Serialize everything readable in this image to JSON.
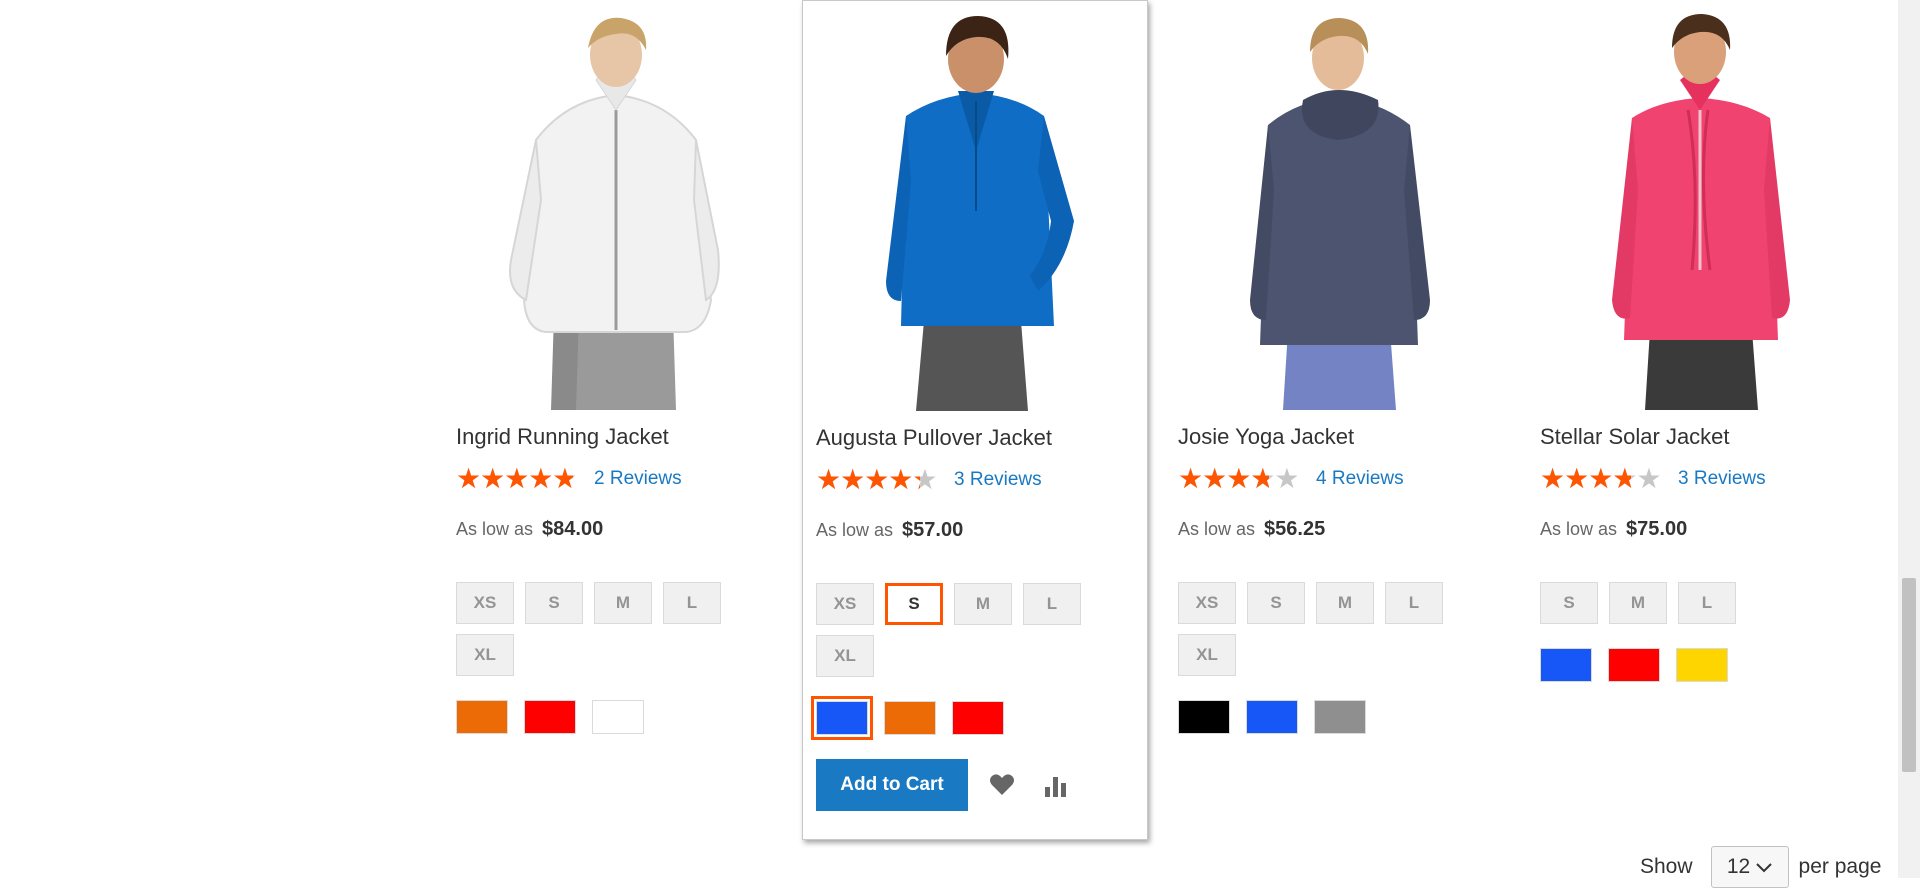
{
  "products": [
    {
      "name": "Ingrid Running Jacket",
      "rating": 4.5,
      "reviews": "2 Reviews",
      "price_label": "As low as",
      "price": "$84.00",
      "sizes": [
        "XS",
        "S",
        "M",
        "L",
        "XL"
      ],
      "selected_size": null,
      "colors": [
        "#ec6b06",
        "#ff0000",
        "#ffffff"
      ],
      "selected_color": null,
      "image": "white-zip-jacket"
    },
    {
      "name": "Augusta Pullover Jacket",
      "rating": 4.0,
      "reviews": "3 Reviews",
      "price_label": "As low as",
      "price": "$57.00",
      "sizes": [
        "XS",
        "S",
        "M",
        "L",
        "XL"
      ],
      "selected_size": "S",
      "colors": [
        "#1857f7",
        "#ec6b06",
        "#ff0000"
      ],
      "selected_color": "#1857f7",
      "image": "blue-pullover",
      "add_to_cart": "Add to Cart"
    },
    {
      "name": "Josie Yoga Jacket",
      "rating": 3.5,
      "reviews": "4 Reviews",
      "price_label": "As low as",
      "price": "$56.25",
      "sizes": [
        "XS",
        "S",
        "M",
        "L",
        "XL"
      ],
      "selected_size": null,
      "colors": [
        "#000000",
        "#1857f7",
        "#8f8f8f"
      ],
      "selected_color": null,
      "image": "navy-cowl-jacket"
    },
    {
      "name": "Stellar Solar Jacket",
      "rating": 3.5,
      "reviews": "3 Reviews",
      "price_label": "As low as",
      "price": "$75.00",
      "sizes": [
        "S",
        "M",
        "L"
      ],
      "selected_size": null,
      "colors": [
        "#1857f7",
        "#ff0000",
        "#ffd500"
      ],
      "selected_color": null,
      "image": "pink-ruched-jacket"
    }
  ],
  "toolbar": {
    "show_label": "Show",
    "limit_value": "12",
    "per_page_label": "per page"
  },
  "icons": {
    "wishlist": "heart-icon",
    "compare": "bar-chart-icon",
    "limiter": "chevron-down-icon"
  },
  "colors": {
    "accent": "#1979c3",
    "star": "#ff5501",
    "selection": "#ff5501"
  }
}
